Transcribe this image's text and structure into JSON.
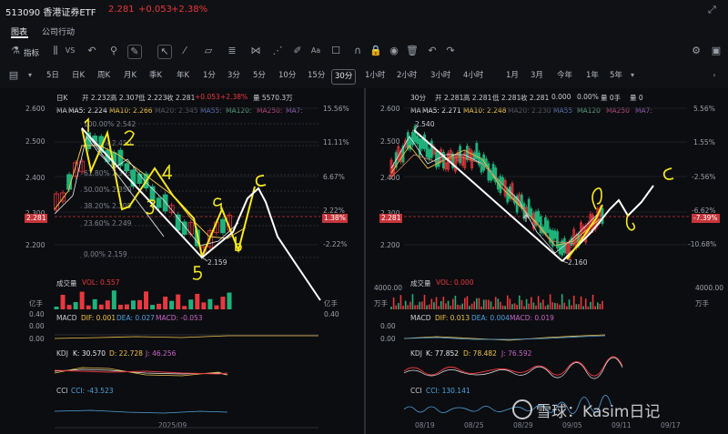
{
  "header": {
    "code_name": "513090 香港证券ETF",
    "price": "2.281",
    "change": "+0.053",
    "change_pct": "+2.38%"
  },
  "tabs": [
    "图表",
    "公司行动"
  ],
  "toolbar": {
    "indicator_label": "指标"
  },
  "periods": [
    "5日",
    "日K",
    "周K",
    "月K",
    "季K",
    "年K",
    "1分",
    "3分",
    "5分",
    "10分",
    "15分",
    "30分",
    "1小时",
    "2小时",
    "3小时",
    "4小时",
    "1月",
    "3月",
    "今年",
    "1年",
    "5年"
  ],
  "active_period": "30分",
  "left": {
    "info": {
      "label": "日K",
      "open": "开 2.232",
      "high": "高 2.307",
      "low": "低 2.223",
      "close": "收 2.281",
      "chg": "+0.053",
      "pct": "+2.38%",
      "vol": "量 5570.3万"
    },
    "ma": {
      "label": "MA",
      "ma5": "MA5: 2.224",
      "ma10": "MA10: 2.266",
      "ma20": "MA20: 2.345",
      "ma55": "MA55:",
      "ma120": "MA120:",
      "ma250": "MA250:",
      "ma7": "MA7:"
    },
    "yaxis": [
      "2.600",
      "2.500",
      "2.400",
      "2.300",
      "2.200"
    ],
    "price_tag": "2.281",
    "pct_axis": [
      "15.56%",
      "11.11%",
      "6.67%",
      "2.22%",
      "-2.22%"
    ],
    "pct_tag": "1.38%",
    "fib": [
      "100.00% 2.542",
      "76.40% 2.450",
      "61.80% 2.393",
      "50.00% 2.350",
      "38.20% 2.305",
      "23.60% 2.249",
      "0.00% 2.159"
    ],
    "low_label": "2.159",
    "annotations": [
      "1",
      "2",
      "3",
      "4",
      "5",
      "a",
      "b",
      "c"
    ],
    "vol": {
      "label": "成交量",
      "value": "VOL: 0.557",
      "unit": "亿手",
      "scale": "0.40"
    },
    "macd": {
      "label": "MACD",
      "dif": "DIF: 0.001",
      "dea": "DEA: 0.027",
      "macd": "MACD: -0.053",
      "y1": "0.00",
      "y0": "0.00"
    },
    "kdj": {
      "label": "KDJ",
      "k": "K: 30.570",
      "d": "D: 22.728",
      "j": "J: 46.256"
    },
    "cci": {
      "label": "CCI",
      "value": "CCI: -43.523"
    },
    "date": "2025/09",
    "right_axis": {
      "unit": "亿手",
      "scale": "0.40"
    }
  },
  "right": {
    "info": {
      "label": "30分",
      "open": "开 2.281",
      "high": "高 2.281",
      "low": "低 2.281",
      "close": "收 2.281",
      "chg": "0.000",
      "pct": "0.00%",
      "vol": "量 0手",
      "vol2": "量 0"
    },
    "ma": {
      "label": "MA",
      "ma5": "MA5: 2.271",
      "ma10": "MA10: 2.248",
      "ma20": "MA20: 2.230",
      "ma55": "MA55",
      "ma120": "MA120",
      "ma250": "MA250",
      "ma7": "MA7:"
    },
    "yaxis": [
      "2.600",
      "2.500",
      "2.400",
      "2.300",
      "2.200"
    ],
    "price_tag": "2.281",
    "pct_axis": [
      "5.56%",
      "1.55%",
      "-2.56%",
      "-6.62%",
      "-10.68%"
    ],
    "pct_tag": "-7.39%",
    "high_label": "2.540",
    "low_label": "2.160",
    "annotations": [
      "a",
      "b",
      "c"
    ],
    "vol": {
      "label": "成交量",
      "value": "VOL: 0.000",
      "scale_l": "4000.00",
      "unit_l": "万手",
      "scale_r": "4000.00",
      "unit_r": "万手"
    },
    "macd": {
      "label": "MACD",
      "dif": "DIF: 0.013",
      "dea": "DEA: 0.004",
      "macd": "MACD: 0.019",
      "y1": "0.00",
      "y0": "0.00"
    },
    "kdj": {
      "label": "KDJ",
      "k": "K: 77.852",
      "d": "D: 78.482",
      "j": "J: 76.592"
    },
    "cci": {
      "label": "CCI",
      "value": "CCI: 130.141"
    },
    "dates": [
      "08/19",
      "08/25",
      "08/29",
      "09/05",
      "09/11",
      "09/17"
    ]
  },
  "watermark": "雪球：Kasim日记",
  "colors": {
    "up": "#e8383f",
    "down": "#1fb27a",
    "accent": "#f7e91c",
    "bg": "#0c0d10"
  }
}
